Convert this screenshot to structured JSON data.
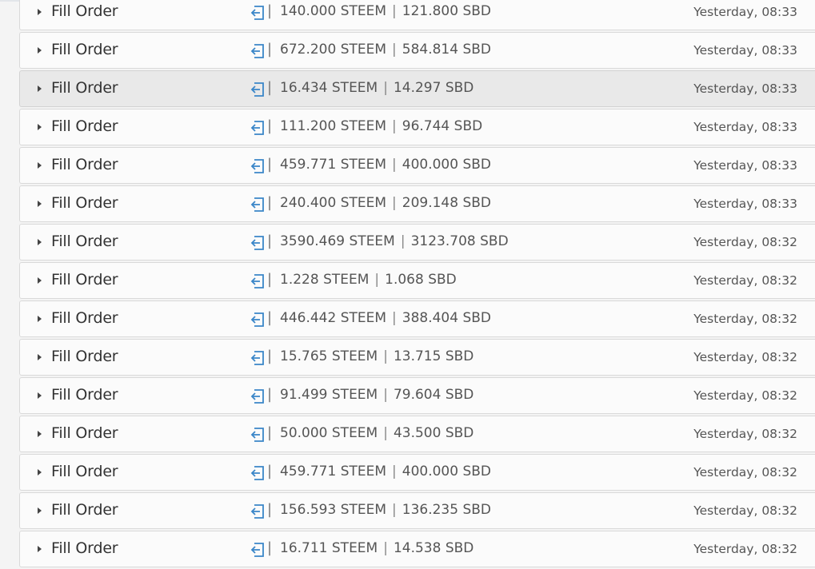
{
  "operations": [
    {
      "type": "Fill Order",
      "steem": "140.000 STEEM",
      "sbd": "121.800 SBD",
      "time": "Yesterday, 08:33"
    },
    {
      "type": "Fill Order",
      "steem": "672.200 STEEM",
      "sbd": "584.814 SBD",
      "time": "Yesterday, 08:33"
    },
    {
      "type": "Fill Order",
      "steem": "16.434 STEEM",
      "sbd": "14.297 SBD",
      "time": "Yesterday, 08:33"
    },
    {
      "type": "Fill Order",
      "steem": "111.200 STEEM",
      "sbd": "96.744 SBD",
      "time": "Yesterday, 08:33"
    },
    {
      "type": "Fill Order",
      "steem": "459.771 STEEM",
      "sbd": "400.000 SBD",
      "time": "Yesterday, 08:33"
    },
    {
      "type": "Fill Order",
      "steem": "240.400 STEEM",
      "sbd": "209.148 SBD",
      "time": "Yesterday, 08:33"
    },
    {
      "type": "Fill Order",
      "steem": "3590.469 STEEM",
      "sbd": "3123.708 SBD",
      "time": "Yesterday, 08:32"
    },
    {
      "type": "Fill Order",
      "steem": "1.228 STEEM",
      "sbd": "1.068 SBD",
      "time": "Yesterday, 08:32"
    },
    {
      "type": "Fill Order",
      "steem": "446.442 STEEM",
      "sbd": "388.404 SBD",
      "time": "Yesterday, 08:32"
    },
    {
      "type": "Fill Order",
      "steem": "15.765 STEEM",
      "sbd": "13.715 SBD",
      "time": "Yesterday, 08:32"
    },
    {
      "type": "Fill Order",
      "steem": "91.499 STEEM",
      "sbd": "79.604 SBD",
      "time": "Yesterday, 08:32"
    },
    {
      "type": "Fill Order",
      "steem": "50.000 STEEM",
      "sbd": "43.500 SBD",
      "time": "Yesterday, 08:32"
    },
    {
      "type": "Fill Order",
      "steem": "459.771 STEEM",
      "sbd": "400.000 SBD",
      "time": "Yesterday, 08:32"
    },
    {
      "type": "Fill Order",
      "steem": "156.593 STEEM",
      "sbd": "136.235 SBD",
      "time": "Yesterday, 08:32"
    },
    {
      "type": "Fill Order",
      "steem": "16.711 STEEM",
      "sbd": "14.538 SBD",
      "time": "Yesterday, 08:32"
    }
  ],
  "separator": "|",
  "highlighted_row": 2,
  "colors": {
    "icon_blue": "#3a86c8",
    "row_bg": "#fbfbfb",
    "row_highlight": "#e9e9e9"
  },
  "icons": {
    "row_type": "sign-in-icon",
    "expand": "caret-right-icon"
  }
}
